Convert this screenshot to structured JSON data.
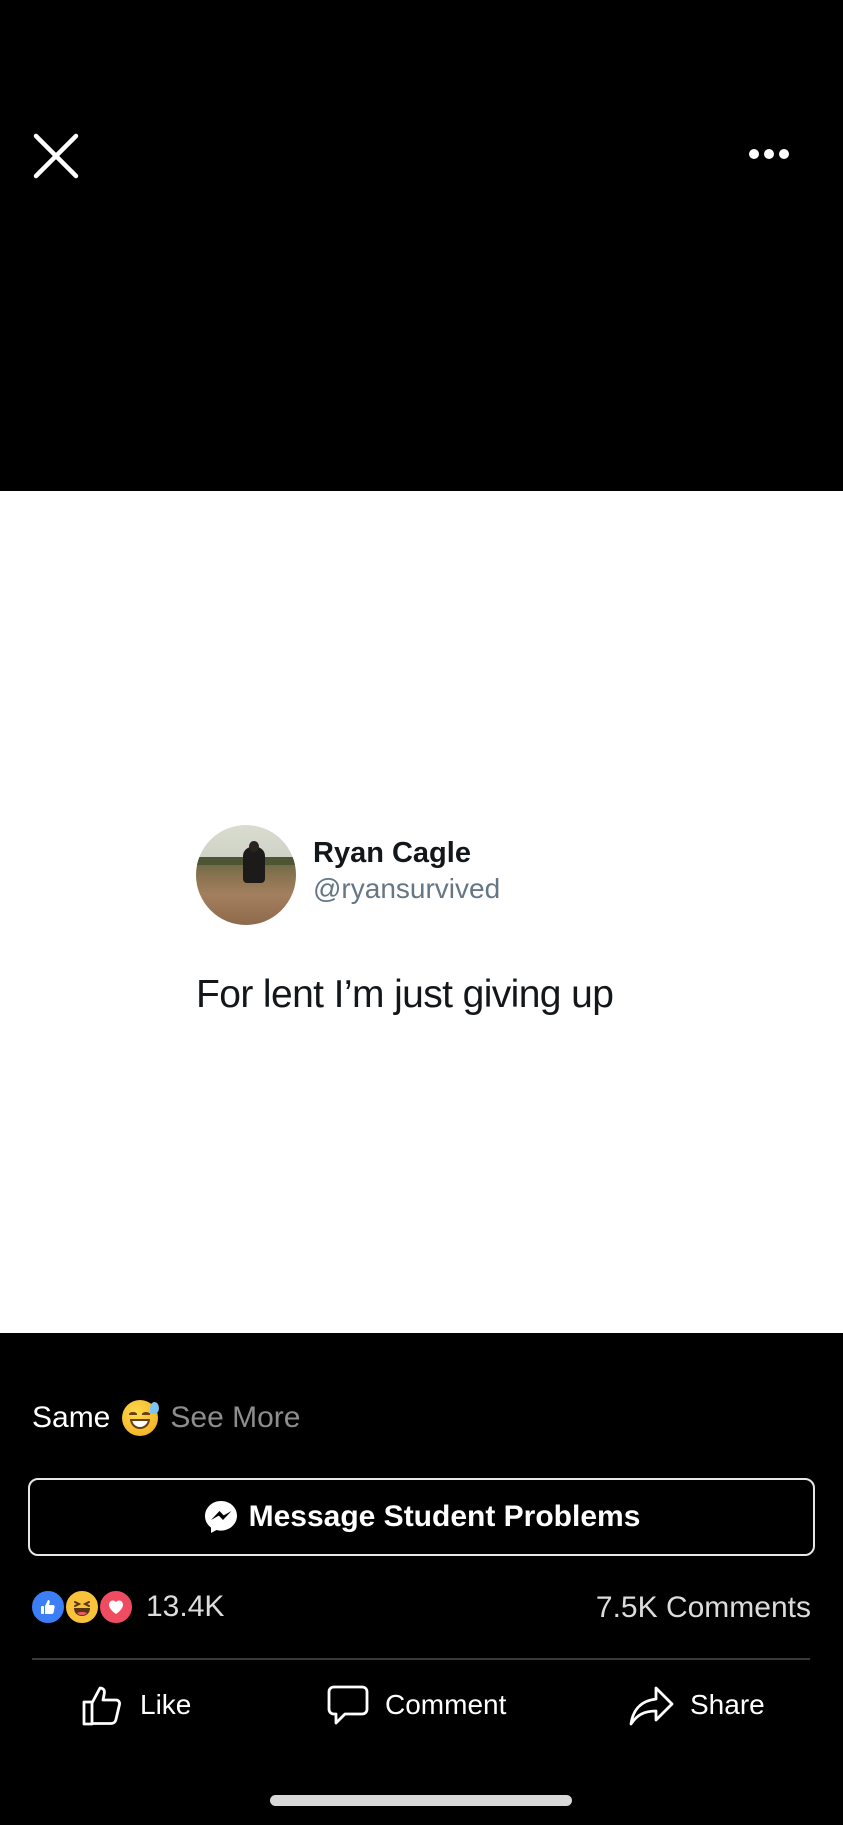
{
  "top_bar": {
    "close_icon": "close-icon",
    "more_icon": "more-horizontal-icon"
  },
  "photo": {
    "tweet": {
      "name": "Ryan Cagle",
      "handle": "@ryansurvived",
      "text": "For lent I’m just giving up"
    }
  },
  "caption": {
    "text": "Same",
    "emoji": "grinning-face-with-sweat",
    "see_more": "See More"
  },
  "message_button": {
    "label": "Message Student Problems",
    "icon": "messenger-icon"
  },
  "stats": {
    "reactions": [
      "like",
      "haha",
      "love"
    ],
    "reaction_count": "13.4K",
    "comments": "7.5K Comments"
  },
  "actions": {
    "like": "Like",
    "comment": "Comment",
    "share": "Share"
  },
  "colors": {
    "background": "#000000",
    "like_blue": "#3b7ef6",
    "haha_yellow": "#f8c23a",
    "love_red": "#ef4b61",
    "muted_text": "#8d8d8d"
  }
}
